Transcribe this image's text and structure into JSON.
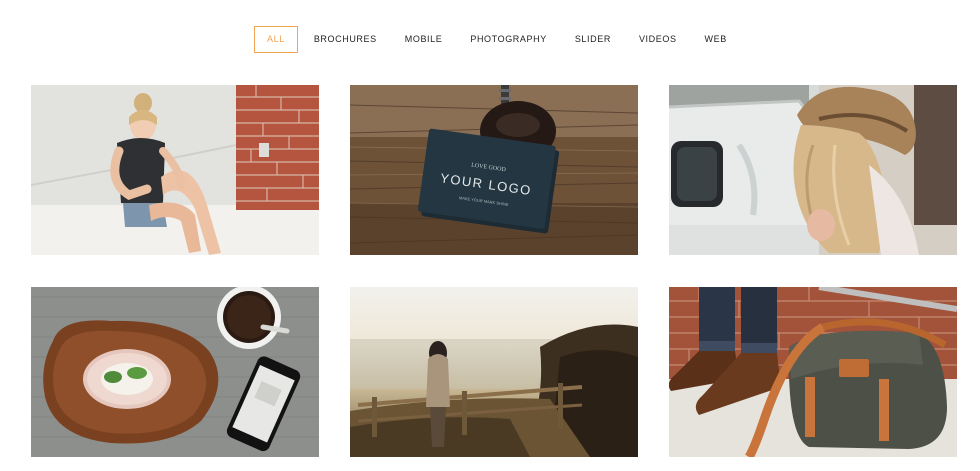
{
  "filters": [
    {
      "label": "ALL",
      "active": true
    },
    {
      "label": "BROCHURES",
      "active": false
    },
    {
      "label": "MOBILE",
      "active": false
    },
    {
      "label": "PHOTOGRAPHY",
      "active": false
    },
    {
      "label": "SLIDER",
      "active": false
    },
    {
      "label": "VIDEOS",
      "active": false
    },
    {
      "label": "WEB",
      "active": false
    }
  ],
  "portfolio": {
    "card_logo": {
      "top": "LOVE GOOD",
      "main": "YOUR LOGO",
      "bottom": "MAKE YOUR MARK SHINE"
    }
  },
  "colors": {
    "accent": "#f0a552"
  }
}
